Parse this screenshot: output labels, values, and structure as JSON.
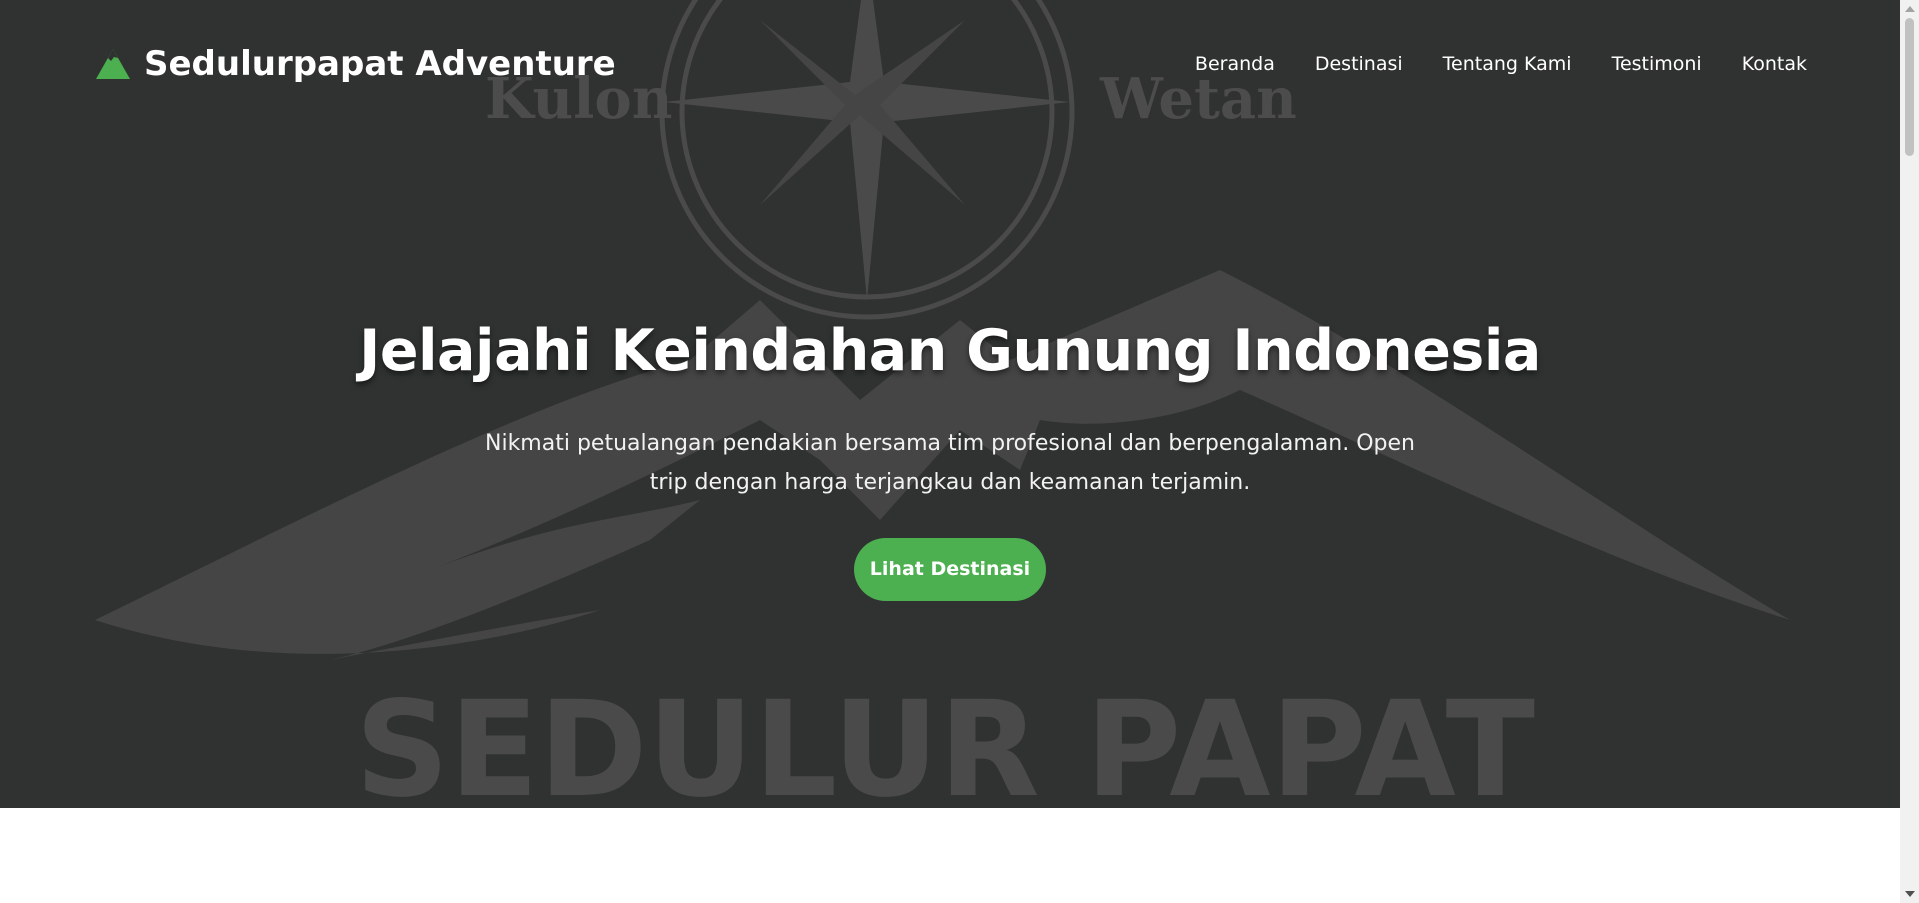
{
  "brand": {
    "name": "Sedulurpapat Adventure",
    "icon": "mountain-icon",
    "icon_color": "#4caf50"
  },
  "nav": {
    "items": [
      {
        "label": "Beranda"
      },
      {
        "label": "Destinasi"
      },
      {
        "label": "Tentang Kami"
      },
      {
        "label": "Testimoni"
      },
      {
        "label": "Kontak"
      }
    ]
  },
  "hero": {
    "title": "Jelajahi Keindahan Gunung Indonesia",
    "subtitle": "Nikmati petualangan pendakian bersama tim profesional dan berpengalaman. Open trip dengan harga terjangkau dan keamanan terjamin.",
    "cta_label": "Lihat Destinasi",
    "background_color": "#2f3230"
  },
  "watermark": {
    "left_word": "Kulon",
    "right_word": "Wetan",
    "big_text": "SEDULUR PAPAT"
  },
  "colors": {
    "accent": "#4caf50",
    "text": "#ffffff"
  }
}
